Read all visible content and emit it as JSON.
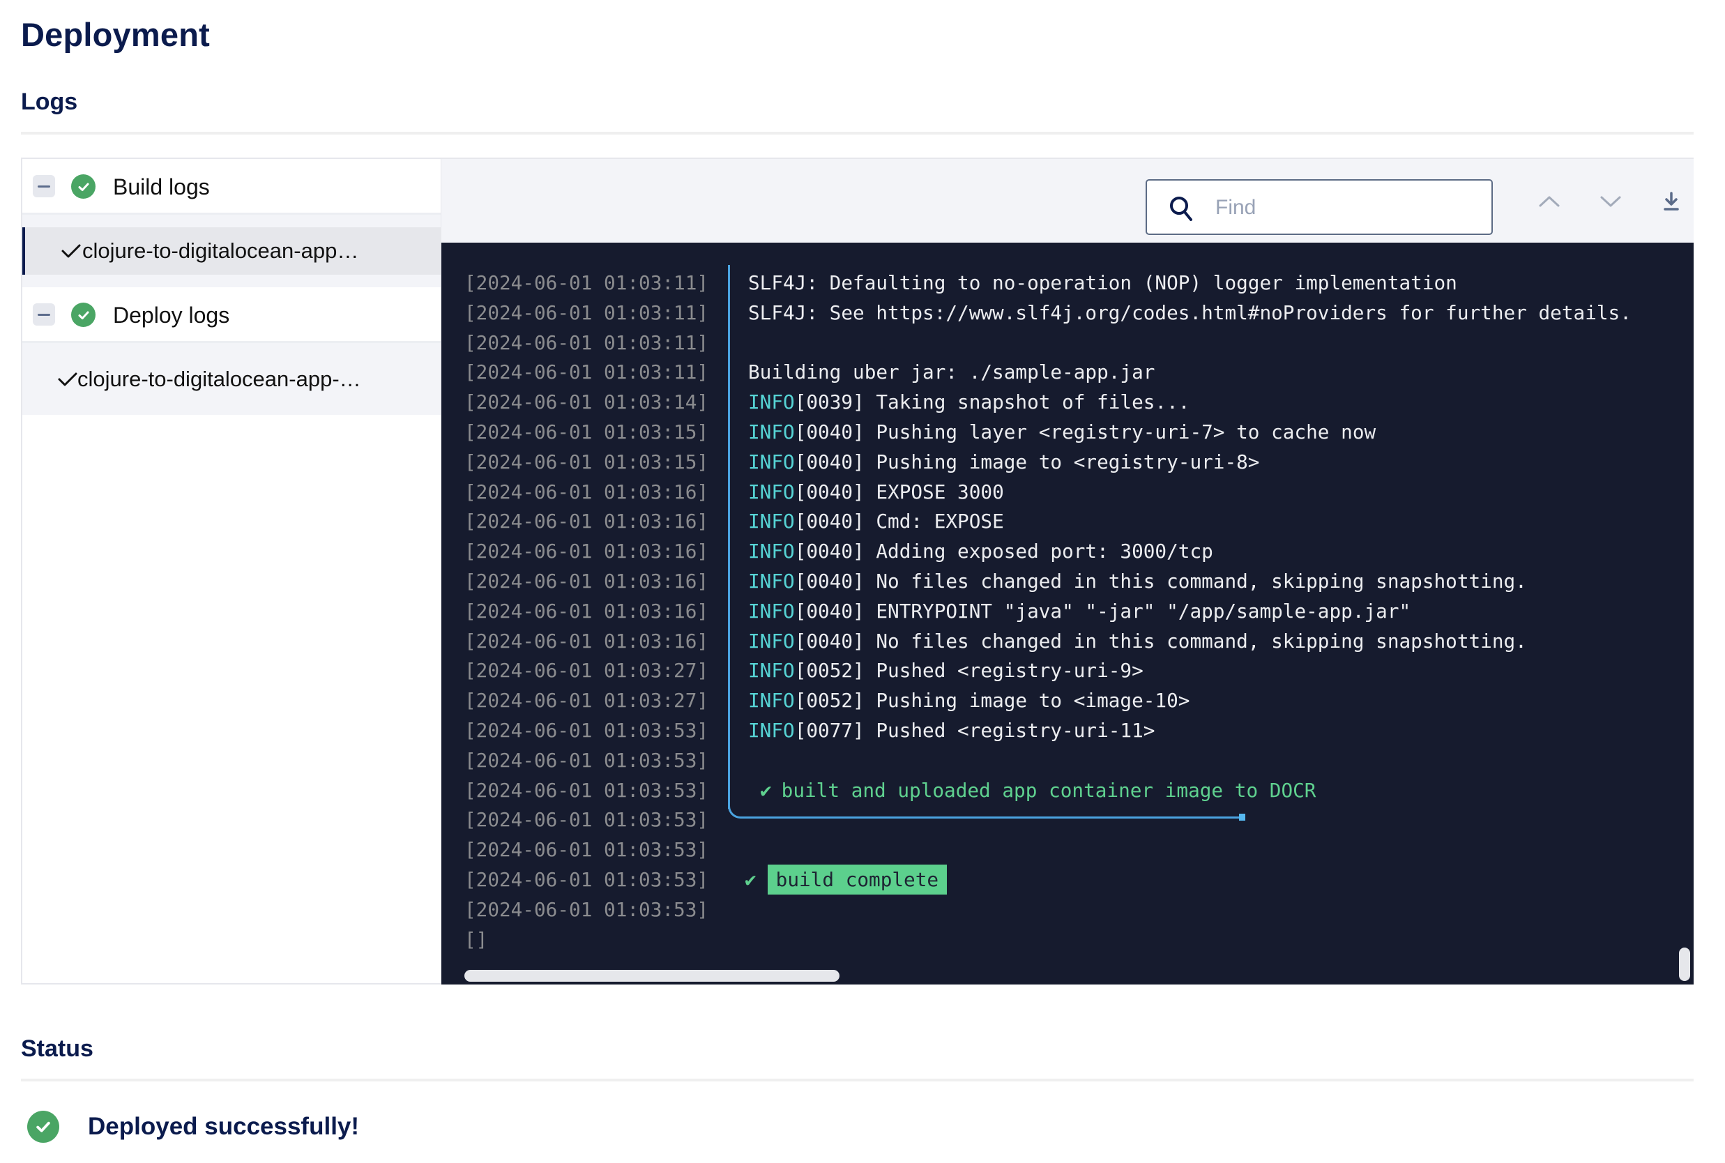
{
  "page": {
    "title": "Deployment"
  },
  "logs_section": {
    "title": "Logs",
    "tree": [
      {
        "label": "Build logs",
        "status": "success",
        "expanded": true,
        "children": [
          {
            "label": "clojure-to-digitalocean-app…",
            "status": "success",
            "selected": true
          }
        ]
      },
      {
        "label": "Deploy logs",
        "status": "success",
        "expanded": true,
        "children": [
          {
            "label": "clojure-to-digitalocean-app-…",
            "status": "success",
            "selected": false
          }
        ]
      }
    ],
    "toolbar": {
      "find_placeholder": "Find",
      "find_value": "",
      "icons": [
        "search-icon",
        "chevron-up-icon",
        "chevron-down-icon",
        "download-icon"
      ]
    },
    "log_lines": [
      {
        "ts": "[2024-06-01 01:03:11]",
        "level": "",
        "text": "SLF4J: Defaulting to no-operation (NOP) logger implementation"
      },
      {
        "ts": "[2024-06-01 01:03:11]",
        "level": "",
        "text": "SLF4J: See https://www.slf4j.org/codes.html#noProviders for further details."
      },
      {
        "ts": "[2024-06-01 01:03:11]",
        "level": "",
        "text": ""
      },
      {
        "ts": "[2024-06-01 01:03:11]",
        "level": "",
        "text": "Building uber jar: ./sample-app.jar"
      },
      {
        "ts": "[2024-06-01 01:03:14]",
        "level": "INFO",
        "text": "[0039] Taking snapshot of files..."
      },
      {
        "ts": "[2024-06-01 01:03:15]",
        "level": "INFO",
        "text": "[0040] Pushing layer <registry-uri-7> to cache now"
      },
      {
        "ts": "[2024-06-01 01:03:15]",
        "level": "INFO",
        "text": "[0040] Pushing image to <registry-uri-8>"
      },
      {
        "ts": "[2024-06-01 01:03:16]",
        "level": "INFO",
        "text": "[0040] EXPOSE 3000"
      },
      {
        "ts": "[2024-06-01 01:03:16]",
        "level": "INFO",
        "text": "[0040] Cmd: EXPOSE"
      },
      {
        "ts": "[2024-06-01 01:03:16]",
        "level": "INFO",
        "text": "[0040] Adding exposed port: 3000/tcp"
      },
      {
        "ts": "[2024-06-01 01:03:16]",
        "level": "INFO",
        "text": "[0040] No files changed in this command, skipping snapshotting."
      },
      {
        "ts": "[2024-06-01 01:03:16]",
        "level": "INFO",
        "text": "[0040] ENTRYPOINT \"java\" \"-jar\" \"/app/sample-app.jar\""
      },
      {
        "ts": "[2024-06-01 01:03:16]",
        "level": "INFO",
        "text": "[0040] No files changed in this command, skipping snapshotting."
      },
      {
        "ts": "[2024-06-01 01:03:27]",
        "level": "INFO",
        "text": "[0052] Pushed <registry-uri-9>"
      },
      {
        "ts": "[2024-06-01 01:03:27]",
        "level": "INFO",
        "text": "[0052] Pushing image to <image-10>"
      },
      {
        "ts": "[2024-06-01 01:03:53]",
        "level": "INFO",
        "text": "[0077] Pushed <registry-uri-11>"
      },
      {
        "ts": "[2024-06-01 01:03:53]",
        "level": "",
        "text": ""
      },
      {
        "ts": "[2024-06-01 01:03:53]",
        "level": "",
        "text": "built and uploaded app container image to DOCR",
        "kind": "step-success"
      },
      {
        "ts": "[2024-06-01 01:03:53]",
        "level": "",
        "text": ""
      },
      {
        "ts": "[2024-06-01 01:03:53]",
        "level": "",
        "text": ""
      },
      {
        "ts": "[2024-06-01 01:03:53]",
        "level": "",
        "text": "build complete",
        "kind": "final-success"
      },
      {
        "ts": "[2024-06-01 01:03:53]",
        "level": "",
        "text": ""
      }
    ],
    "cursor_line": "[]",
    "check_glyph": "✔",
    "info_label": "INFO"
  },
  "status_section": {
    "title": "Status",
    "message": "Deployed successfully!",
    "state": "success"
  },
  "colors": {
    "brand_navy": "#0b1b4d",
    "success_green": "#4aa564",
    "log_background": "#161b2e",
    "info_cyan": "#56d3d4",
    "log_success_green": "#5fd18f",
    "connector_blue": "#4aa3e0"
  }
}
